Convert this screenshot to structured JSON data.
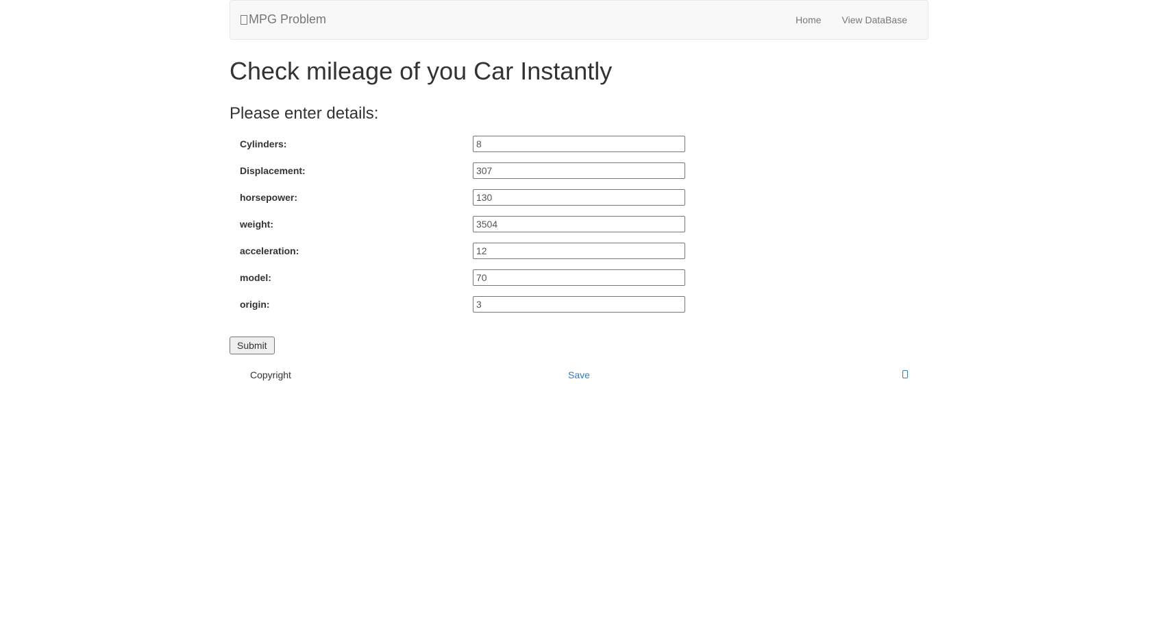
{
  "navbar": {
    "brand": "MPG Problem",
    "links": [
      {
        "label": "Home"
      },
      {
        "label": "View DataBase"
      }
    ]
  },
  "page": {
    "title": "Check mileage of you Car Instantly",
    "subtitle": "Please enter details:"
  },
  "form": {
    "fields": [
      {
        "label": "Cylinders:",
        "value": "8",
        "name": "cylinders"
      },
      {
        "label": "Displacement:",
        "value": "307",
        "name": "displacement"
      },
      {
        "label": "horsepower:",
        "value": "130",
        "name": "horsepower"
      },
      {
        "label": "weight:",
        "value": "3504",
        "name": "weight"
      },
      {
        "label": "acceleration:",
        "value": "12",
        "name": "acceleration"
      },
      {
        "label": "model:",
        "value": "70",
        "name": "model"
      },
      {
        "label": "origin:",
        "value": "3",
        "name": "origin"
      }
    ],
    "submit_label": "Submit"
  },
  "footer": {
    "copyright": "Copyright",
    "save_label": "Save"
  }
}
